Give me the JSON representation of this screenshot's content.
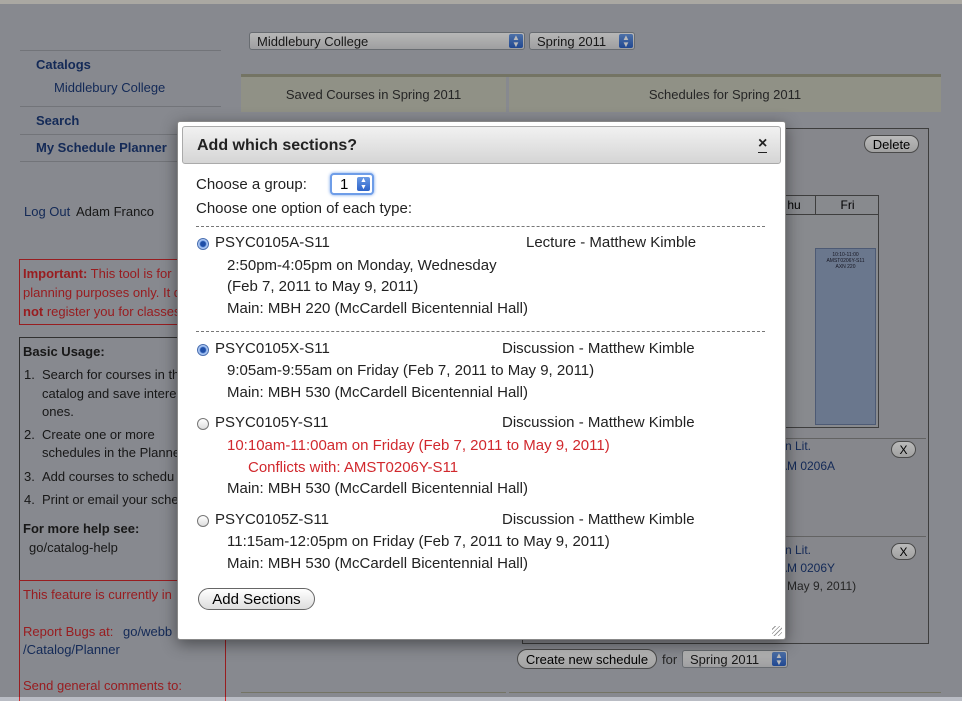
{
  "top_selects": {
    "institution": "Middlebury College",
    "term": "Spring 2011"
  },
  "sidebar": {
    "catalogs_label": "Catalogs",
    "catalog_item": "Middlebury College",
    "search_label": "Search",
    "planner_label": "My Schedule Planner",
    "logout_label": "Log Out",
    "user_name": "Adam Franco",
    "important": {
      "lead": "Important:",
      "l1": " This tool is for",
      "l2": "planning purposes only. It d",
      "l3a": "not",
      "l3b": " register you for classes"
    },
    "usage": {
      "title": "Basic Usage:",
      "items": [
        {
          "n": "1.",
          "l1": "Search for courses in th",
          "l2": "catalog and save intere",
          "l3": "ones."
        },
        {
          "n": "2.",
          "l1": "Create one or more",
          "l2": "schedules in the Planne"
        },
        {
          "n": "3.",
          "l1": "Add courses to schedu"
        },
        {
          "n": "4.",
          "l1": "Print or email your sche"
        }
      ],
      "help_title": "For more help see:",
      "help_link": "go/catalog-help"
    },
    "feature": {
      "l1": "This feature is currently in",
      "bugs_label": "Report Bugs at:",
      "bugs_link1": "go/webb",
      "bugs_link2": "/Catalog/Planner",
      "comments": "Send general comments to:"
    }
  },
  "tabs": {
    "saved": "Saved Courses in Spring 2011",
    "schedules": "Schedules for Spring 2011"
  },
  "schedule": {
    "delete_label": "Delete",
    "days": [
      "hu",
      "Fri"
    ],
    "event_l1": "10:10-11:00",
    "event_l2": "AMST0206Y-S11",
    "event_l3": "AXN 220",
    "courses": [
      {
        "l1": "n Lit.",
        "l2": "AM 0206A"
      },
      {
        "l1": "n Lit.",
        "l2": "AM 0206Y",
        "l3": "May 9, 2011)"
      }
    ],
    "remove_label": "X"
  },
  "bottom": {
    "create_label": "Create new schedule",
    "for_label": "for",
    "term": "Spring 2011"
  },
  "dialog": {
    "title": "Add which sections?",
    "close_label": "×",
    "group_label": "Choose a group:",
    "group_value": "1",
    "instruction": "Choose one option of each type:",
    "sections": [
      {
        "code": "PSYC0105A-S11",
        "type": "Lecture - Matthew Kimble",
        "time": "2:50pm-4:05pm on Monday, Wednesday",
        "dates": "(Feb 7, 2011 to May 9, 2011)",
        "location": "Main: MBH 220 (McCardell Bicentennial Hall)"
      },
      {
        "code": "PSYC0105X-S11",
        "type": "Discussion - Matthew Kimble",
        "time": "9:05am-9:55am on Friday (Feb 7, 2011 to May 9, 2011)",
        "location": "Main: MBH 530 (McCardell Bicentennial Hall)"
      },
      {
        "code": "PSYC0105Y-S11",
        "type": "Discussion - Matthew Kimble",
        "time": "10:10am-11:00am on Friday (Feb 7, 2011 to May 9, 2011)",
        "conflict": "Conflicts with: AMST0206Y-S11",
        "location": "Main: MBH 530 (McCardell Bicentennial Hall)"
      },
      {
        "code": "PSYC0105Z-S11",
        "type": "Discussion - Matthew Kimble",
        "time": "11:15am-12:05pm on Friday (Feb 7, 2011 to May 9, 2011)",
        "location": "Main: MBH 530 (McCardell Bicentennial Hall)"
      }
    ],
    "add_button": "Add Sections"
  },
  "colors": {
    "accent_red": "#d1282d",
    "link_blue": "#1c3a78",
    "radio_blue": "#1f4fa8"
  }
}
